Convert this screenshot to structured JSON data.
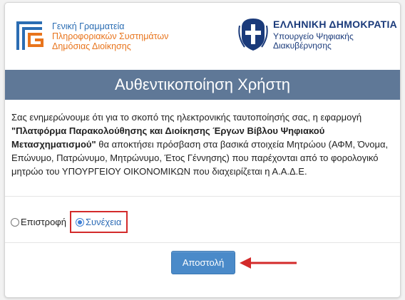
{
  "header": {
    "gsis_logo": {
      "line1": "Γενική Γραμματεία",
      "line2": "Πληροφοριακών Συστημάτων",
      "line3": "Δημόσιας Διοίκησης"
    },
    "gov_logo": {
      "line1": "ΕΛΛΗΝΙΚΗ ΔΗΜΟΚΡΑΤΙΑ",
      "line2": "Υπουργείο Ψηφιακής",
      "line3": "Διακυβέρνησης"
    }
  },
  "title": "Αυθεντικοποίηση Χρήστη",
  "message": {
    "intro": "Σας ενημερώνουμε ότι για το σκοπό της ηλεκτρονικής ταυτοποίησής σας, η εφαρμογή",
    "app_name": "\"Πλατφόρμα Παρακολούθησης και Διοίκησης Έργων Βίβλου Ψηφιακού Μετασχηματισμού\"",
    "rest": " θα αποκτήσει πρόσβαση στα βασικά στοιχεία Μητρώου (ΑΦΜ, Όνομα, Επώνυμο, Πατρώνυμο, Μητρώνυμο, Έτος Γέννησης) που παρέχονται από το φορολογικό μητρώο του ΥΠΟΥΡΓΕΙΟΥ ΟΙΚΟΝΟΜΙΚΩΝ που διαχειρίζεται η Α.Α.Δ.Ε."
  },
  "options": [
    {
      "label": "Επιστροφή",
      "checked": false
    },
    {
      "label": "Συνέχεια",
      "checked": true
    }
  ],
  "submit_label": "Αποστολή",
  "colors": {
    "title_band": "#5f7897",
    "button": "#4a8ac9",
    "highlight": "#d32a2a",
    "gsis_blue": "#2b6db3",
    "gsis_orange": "#e8741c",
    "gov_blue": "#1a3a7a"
  }
}
